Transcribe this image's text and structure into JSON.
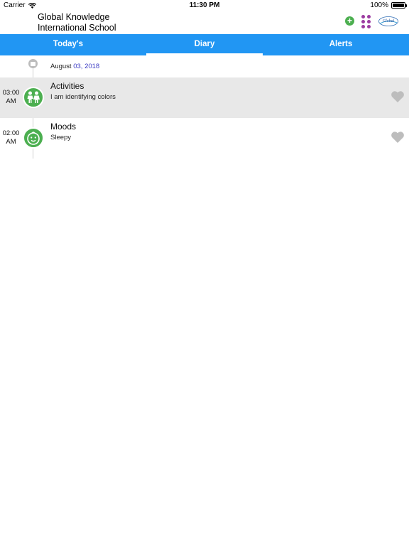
{
  "status_bar": {
    "carrier": "Carrier",
    "time": "11:30 PM",
    "battery_percent": "100%",
    "battery_level": 1.0
  },
  "header": {
    "school_name_line1": "Global Knowledge",
    "school_name_line2": "International School",
    "add_icon": "plus-circle-icon",
    "apps_icon": "grid-dots-icon",
    "logo_text": "Global"
  },
  "tabs": [
    {
      "label": "Today's",
      "active": false
    },
    {
      "label": "Diary",
      "active": true
    },
    {
      "label": "Alerts",
      "active": false
    }
  ],
  "diary": {
    "date_month": "August",
    "date_day_year": "03, 2018",
    "entries": [
      {
        "time_hm": "03:00",
        "time_ampm": "AM",
        "title": "Activities",
        "description": "I am identifying colors",
        "icon": "children-icon"
      },
      {
        "time_hm": "02:00",
        "time_ampm": "AM",
        "title": "Moods",
        "description": "Sleepy",
        "icon": "baby-face-icon"
      }
    ]
  },
  "colors": {
    "tab_bar": "#2196f3",
    "icon_green": "#4caf50",
    "apps_purple": "#9c3ba1",
    "row_shade": "#e8e8e8",
    "heart_grey": "#bdbdbd"
  }
}
